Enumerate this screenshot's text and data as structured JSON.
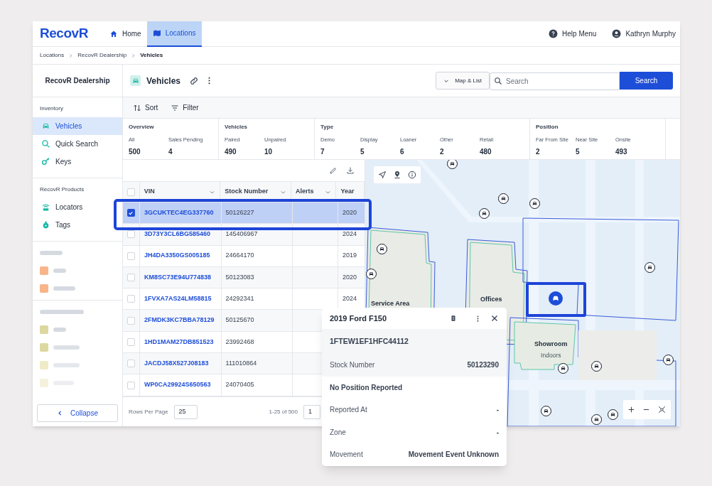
{
  "header": {
    "logo": "RecovR",
    "nav": [
      {
        "label": "Home",
        "selected": false
      },
      {
        "label": "Locations",
        "selected": true
      }
    ],
    "help": "Help Menu",
    "user": "Kathryn Murphy"
  },
  "breadcrumb": [
    "Locations",
    "RecovR Dealership",
    "Vehicles"
  ],
  "sidebar": {
    "title": "RecovR Dealership",
    "sections": [
      {
        "label": "Inventory",
        "items": [
          {
            "label": "Vehicles",
            "selected": true
          },
          {
            "label": "Quick Search",
            "selected": false
          },
          {
            "label": "Keys",
            "selected": false
          }
        ]
      },
      {
        "label": "RecovR Products",
        "items": [
          {
            "label": "Locators",
            "selected": false
          },
          {
            "label": "Tags",
            "selected": false
          }
        ]
      }
    ],
    "collapse": "Collapse"
  },
  "page": {
    "title": "Vehicles",
    "view_toggle": "Map & List",
    "search": {
      "placeholder": "Search"
    },
    "search_button": "Search"
  },
  "toolbar": [
    "Sort",
    "Filter"
  ],
  "stats": [
    {
      "title": "Overview",
      "items": [
        {
          "label": "All",
          "value": "500"
        },
        {
          "label": "Sales Pending",
          "value": "4"
        }
      ]
    },
    {
      "title": "Vehicles",
      "items": [
        {
          "label": "Paired",
          "value": "490"
        },
        {
          "label": "Unpaired",
          "value": "10"
        }
      ]
    },
    {
      "title": "Type",
      "items": [
        {
          "label": "Demo",
          "value": "7"
        },
        {
          "label": "Display",
          "value": "5"
        },
        {
          "label": "Loaner",
          "value": "6"
        },
        {
          "label": "Other",
          "value": "2"
        },
        {
          "label": "Retail",
          "value": "480"
        }
      ]
    },
    {
      "title": "Position",
      "items": [
        {
          "label": "Far From Site",
          "value": "2"
        },
        {
          "label": "Near Site",
          "value": "5"
        },
        {
          "label": "Onsite",
          "value": "493"
        }
      ]
    }
  ],
  "table": {
    "columns": [
      "VIN",
      "Stock Number",
      "Alerts",
      "Year"
    ],
    "rows": [
      {
        "vin": "3GCUKTEC4EG337760",
        "stock": "50126227",
        "year": "2020",
        "selected": true
      },
      {
        "vin": "3D73Y3CL6BG585460",
        "stock": "145406967",
        "year": "2024",
        "selected": false
      },
      {
        "vin": "JH4DA3350GS005185",
        "stock": "24664170",
        "year": "2019",
        "selected": false
      },
      {
        "vin": "KM8SC73E94U774838",
        "stock": "50123083",
        "year": "2020",
        "selected": false
      },
      {
        "vin": "1FVXA7AS24LM58815",
        "stock": "24292341",
        "year": "2024",
        "selected": false
      },
      {
        "vin": "2FMDK3KC7BBA78129",
        "stock": "50125670",
        "year": "",
        "selected": false
      },
      {
        "vin": "1HD1MAM27DB851523",
        "stock": "23992468",
        "year": "",
        "selected": false
      },
      {
        "vin": "JACDJ58X527J08183",
        "stock": "111010864",
        "year": "",
        "selected": false
      },
      {
        "vin": "WP0CA29924S650563",
        "stock": "24070405",
        "year": "",
        "selected": false
      }
    ],
    "select_all": false,
    "rows_per_page_label": "Rows Per Page",
    "rows_per_page": "25",
    "range": "1-25 of 500",
    "page": "1"
  },
  "map": {
    "labels": [
      {
        "name": "Service Area"
      },
      {
        "name": "Offices"
      },
      {
        "name": "Showroom",
        "sub": "Indoors"
      }
    ],
    "markers": [
      {
        "selected": false
      },
      {
        "selected": false
      },
      {
        "selected": false
      },
      {
        "selected": false
      },
      {
        "selected": false
      },
      {
        "selected": false
      },
      {
        "selected": false
      },
      {
        "selected": true
      },
      {
        "selected": false
      },
      {
        "selected": false
      },
      {
        "selected": false
      },
      {
        "selected": false
      },
      {
        "selected": false
      },
      {
        "selected": false
      }
    ]
  },
  "popup": {
    "title": "2019 Ford F150",
    "vin": "1FTEW1EF1HFC44112",
    "rows": [
      {
        "kind": "pair",
        "label": "Stock Number",
        "value": "50123290"
      },
      {
        "kind": "heading",
        "label": "No Position Reported"
      },
      {
        "kind": "pair",
        "label": "Reported At",
        "value": "-"
      },
      {
        "kind": "pair",
        "label": "Zone",
        "value": "-"
      },
      {
        "kind": "pair",
        "label": "Movement",
        "value": "Movement Event Unknown"
      }
    ]
  }
}
